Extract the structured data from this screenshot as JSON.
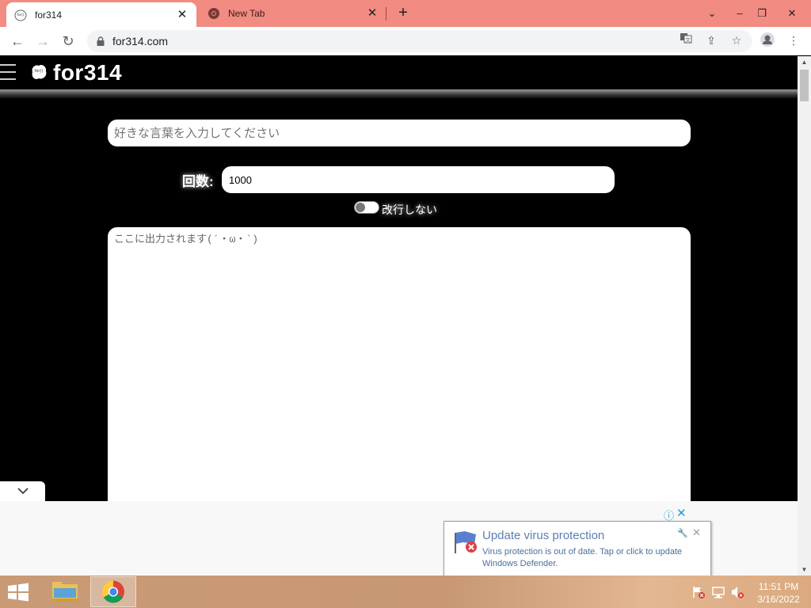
{
  "browser": {
    "tabs": [
      {
        "title": "for314",
        "active": true
      },
      {
        "title": "New Tab",
        "active": false
      }
    ],
    "url": "for314.com"
  },
  "site": {
    "logo_text": "for314",
    "word_input": {
      "placeholder": "好きな言葉を入力してください",
      "value": ""
    },
    "count": {
      "label": "回数:",
      "value": "1000"
    },
    "newline_toggle": {
      "label": "改行しない",
      "on": false
    },
    "output": {
      "placeholder": "ここに出力されます(´・ω・`)",
      "value": ""
    }
  },
  "ad": {
    "notification": {
      "title": "Update virus protection",
      "body": "Virus protection is out of date. Tap or click to update Windows Defender."
    }
  },
  "taskbar": {
    "time": "11:51 PM",
    "date": "3/16/2022"
  },
  "colors": {
    "tabstrip": "#f28b82",
    "page_background": "#000000",
    "accent_link": "#1a9bd7"
  }
}
